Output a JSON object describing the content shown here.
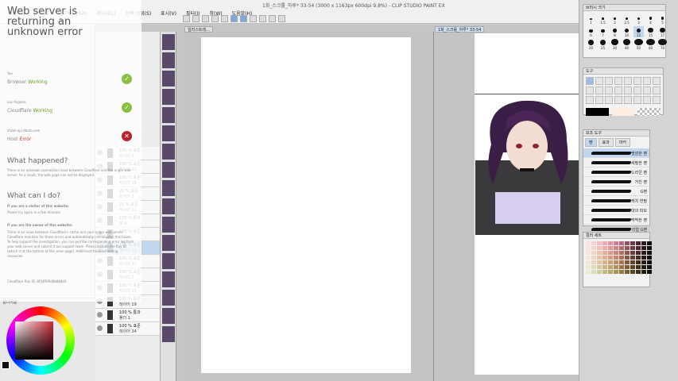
{
  "window": {
    "title": "1화_스크롤_하루* 33-54 (3000 x 1163px 600dpi 9.8%) - CLIP STUDIO PAINT EX",
    "minimize": "─",
    "maximize": "☐",
    "close": "✕"
  },
  "menus": [
    "파일(F)",
    "편집(E)",
    "애니메이션(A)",
    "레이어(L)",
    "선택 범위(S)",
    "표시(V)",
    "필터(I)",
    "창(W)",
    "도움말(H)"
  ],
  "tabs": {
    "canvas1": "일러스트레…",
    "canvas2": "1화_스크롤_하루* 33-54"
  },
  "error_overlay": {
    "title": "Web server is returning an unknown error",
    "rows": [
      {
        "who": "You",
        "what": "Browser",
        "status": "Working",
        "icon": "✓"
      },
      {
        "who": "Los Angeles",
        "what": "Cloudflare",
        "status": "Working",
        "icon": "✓"
      },
      {
        "who": "chzzk-api.dbuto.com",
        "what": "Host",
        "status": "Error",
        "icon": "✕"
      }
    ],
    "what_happened": "What happened?",
    "what_happened_text": "There is an unknown connection issue between Cloudflare and the origin web server. As a result, the web page can not be displayed.",
    "what_can_i_do": "What can I do?",
    "visitor_heading": "If you are a visitor of this website:",
    "visitor_text": "Please try again in a few minutes.",
    "owner_heading": "If you are the owner of this website:",
    "owner_text": "There is an issue between Cloudflare's cache and your origin web server. Cloudflare monitors for these errors and automatically investigates the cause. To help support the investigation, you can pull the corresponding error log from your web server and submit it our support team. Please include the Ray ID (which is at the bottom of this error page). Additional troubleshooting resources.",
    "ray_id": "Cloudflare Ray ID: 8f34f0f6d6b8b8e0"
  },
  "layers": [
    {
      "pct": "100 % 표준",
      "name": "레이어 6"
    },
    {
      "pct": "100 % 표준",
      "name": "레이어 23"
    },
    {
      "pct": "100 % 표준",
      "name": "레이어 18"
    },
    {
      "pct": "20 % 표준",
      "name": "레이어 3"
    },
    {
      "pct": "21 % 표준",
      "name": "레이어 11"
    },
    {
      "pct": "100 % 통과",
      "name": "펜 4"
    },
    {
      "pct": "100 % 표준",
      "name": "펜 2"
    },
    {
      "pct": "100 % 표준",
      "name": "레이어 22"
    },
    {
      "pct": "100 % 표준",
      "name": "레이어 21"
    },
    {
      "pct": "100 % 표준",
      "name": "레이어 2"
    },
    {
      "pct": "100 % 표준",
      "name": "레이어 20"
    },
    {
      "pct": "100 % 표준",
      "name": "레이어 19"
    },
    {
      "pct": "100 % 통과",
      "name": "폴더 1"
    },
    {
      "pct": "100 % 표준",
      "name": "레이어 34"
    }
  ],
  "brush_sizes": [
    "1",
    "1.5",
    "2",
    "2.5",
    "3",
    "4",
    "5",
    "6",
    "7",
    "8",
    "10",
    "12",
    "15",
    "17",
    "20",
    "25",
    "30",
    "40",
    "50",
    "60",
    "70"
  ],
  "brush_list": {
    "tabs": [
      "펜",
      "효과",
      "마커"
    ],
    "items": [
      "명암한 펜",
      "세필한 펜",
      "드라군 펜",
      "거친 펜",
      "G펜",
      "스캐치 연필",
      "막대의 파모",
      "딱딱한 펜",
      "리얼 G펜"
    ]
  },
  "panels": {
    "brush_size": "브러시 크기",
    "tools": "도구",
    "sub_tool": "보조 도구",
    "color_set": "컬러 세트",
    "color_wheel": "컬러서클"
  },
  "colors": {
    "accent": "#7fa7d9",
    "ok": "#8bbf3f",
    "error": "#b8232f"
  }
}
